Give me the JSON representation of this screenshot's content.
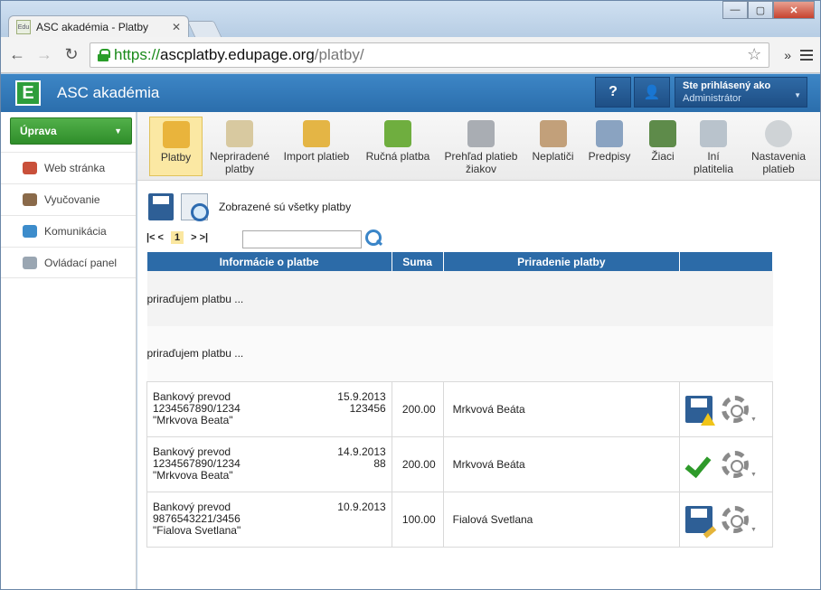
{
  "browser": {
    "tab_title": "ASC akadémia - Platby",
    "favicon_text": "Edu",
    "url_scheme": "https://",
    "url_host": "ascplatby.edupage.org",
    "url_path": "/platby/"
  },
  "app": {
    "name": "ASC akadémia",
    "logo_letter": "E",
    "help_label": "?",
    "user": {
      "line1": "Ste prihlásený ako",
      "line2": "Administrátor"
    }
  },
  "sidebar": {
    "primary_button": "Úprava",
    "items": [
      {
        "label": "Web stránka"
      },
      {
        "label": "Vyučovanie"
      },
      {
        "label": "Komunikácia"
      },
      {
        "label": "Ovládací panel"
      }
    ]
  },
  "toolbar": {
    "items": [
      {
        "label1": "Platby",
        "label2": ""
      },
      {
        "label1": "Nepriradené",
        "label2": "platby"
      },
      {
        "label1": "Import platieb",
        "label2": ""
      },
      {
        "label1": "Ručná platba",
        "label2": ""
      },
      {
        "label1": "Prehľad platieb",
        "label2": "žiakov"
      },
      {
        "label1": "Neplatiči",
        "label2": ""
      },
      {
        "label1": "Predpisy",
        "label2": ""
      },
      {
        "label1": "Žiaci",
        "label2": ""
      },
      {
        "label1": "Iní",
        "label2": "platitelia"
      },
      {
        "label1": "Nastavenia",
        "label2": "platieb"
      }
    ]
  },
  "content": {
    "info_text": "Zobrazené sú všetky platby",
    "pager": {
      "first": "|< <",
      "current": "1",
      "last": "> >|"
    },
    "search_value": "",
    "table": {
      "headers": [
        "Informácie o platbe",
        "Suma",
        "Priradenie platby",
        ""
      ],
      "assigning_text": "priraďujem platbu ...",
      "rows": [
        {
          "type": "Bankový prevod",
          "date": "15.9.2013",
          "account": "1234567890/1234",
          "vs": "123456",
          "payer": "\"Mrkvova Beata\"",
          "amount": "200.00",
          "assigned": "Mrkvová Beáta",
          "status": "warning"
        },
        {
          "type": "Bankový prevod",
          "date": "14.9.2013",
          "account": "1234567890/1234",
          "vs": "88",
          "payer": "\"Mrkvova Beata\"",
          "amount": "200.00",
          "assigned": "Mrkvová Beáta",
          "status": "ok"
        },
        {
          "type": "Bankový prevod",
          "date": "10.9.2013",
          "account": "9876543221/3456",
          "vs": "",
          "payer": "\"Fialova Svetlana\"",
          "amount": "100.00",
          "assigned": "Fialová Svetlana",
          "status": "edit"
        }
      ]
    }
  },
  "colors": {
    "header_blue": "#2c6ba8",
    "accent_green": "#2f8e2a",
    "selected_yellow": "#fbe8a3"
  }
}
